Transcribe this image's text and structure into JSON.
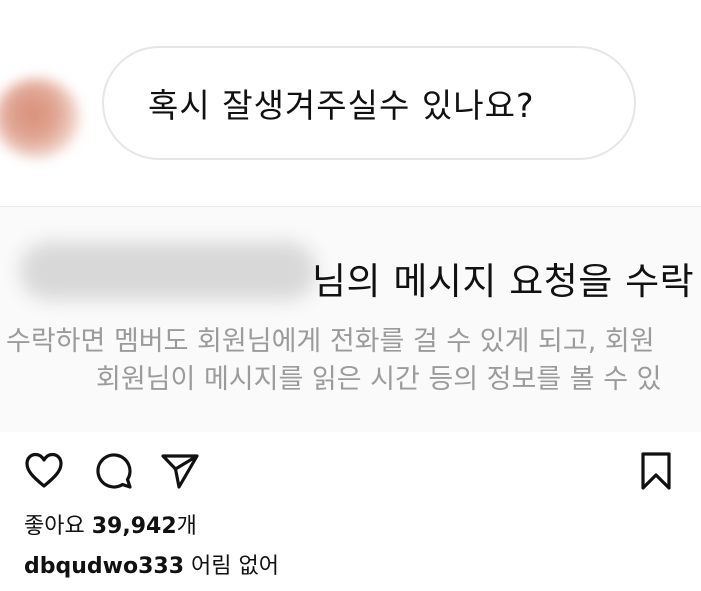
{
  "chat": {
    "message": "혹시 잘생겨주실수 있나요?"
  },
  "request": {
    "title_suffix": "님의 메시지 요청을 수락",
    "desc_line1": "수락하면 멤버도 회원님에게 전화를 걸 수 있게 되고, 회원",
    "desc_line2": "회원님이 메시지를 읽은 시간 등의 정보를 볼 수 있"
  },
  "actions": {
    "like_icon": "heart-icon",
    "comment_icon": "comment-icon",
    "share_icon": "send-icon",
    "save_icon": "bookmark-icon"
  },
  "post": {
    "likes_label": "좋아요",
    "likes_count": "39,942",
    "likes_unit": "개",
    "username": "dbqudwo333",
    "caption": "어림 없어"
  }
}
